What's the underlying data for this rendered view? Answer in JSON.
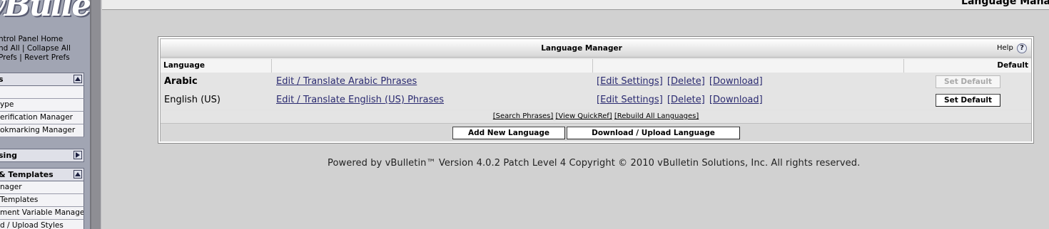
{
  "sidebar": {
    "logo_text": "vBulletin",
    "cp_links": [
      "ntrol Panel Home",
      "nd All | Collapse All",
      "Prefs | Revert Prefs"
    ],
    "groups": [
      {
        "label": "s",
        "toggle": "collapse",
        "items": [
          "",
          "ype",
          "erification Manager",
          "okmarking Manager"
        ]
      },
      {
        "label": "sing",
        "toggle": "expand",
        "items": []
      },
      {
        "label": "& Templates",
        "toggle": "collapse",
        "items": [
          "nager",
          " Templates",
          "ment Variable Manager",
          "d / Upload Styles"
        ]
      }
    ]
  },
  "header": {
    "title": "Language Mana"
  },
  "panel": {
    "title": "Language Manager",
    "help_label": "Help",
    "help_icon": "?",
    "columns": {
      "language": "Language",
      "default": "Default"
    },
    "languages": [
      {
        "name": "Arabic",
        "edit_link": "Edit / Translate Arabic Phrases",
        "edit_settings": "[Edit Settings]",
        "delete": "[Delete]",
        "download": "[Download]",
        "set_default": "Set Default",
        "is_default": true
      },
      {
        "name": "English (US)",
        "edit_link": "Edit / Translate English (US) Phrases",
        "edit_settings": "[Edit Settings]",
        "delete": "[Delete]",
        "download": "[Download]",
        "set_default": "Set Default",
        "is_default": false
      }
    ],
    "links": {
      "search": "[Search Phrases]",
      "quickref": "[View QuickRef]",
      "rebuild": "[Rebuild All Languages]"
    },
    "buttons": {
      "add": "Add New Language",
      "download_upload": "Download / Upload Language"
    }
  },
  "footer": {
    "text": "Powered by vBulletin™ Version 4.0.2 Patch Level 4 Copyright © 2010 vBulletin Solutions, Inc. All rights reserved."
  }
}
